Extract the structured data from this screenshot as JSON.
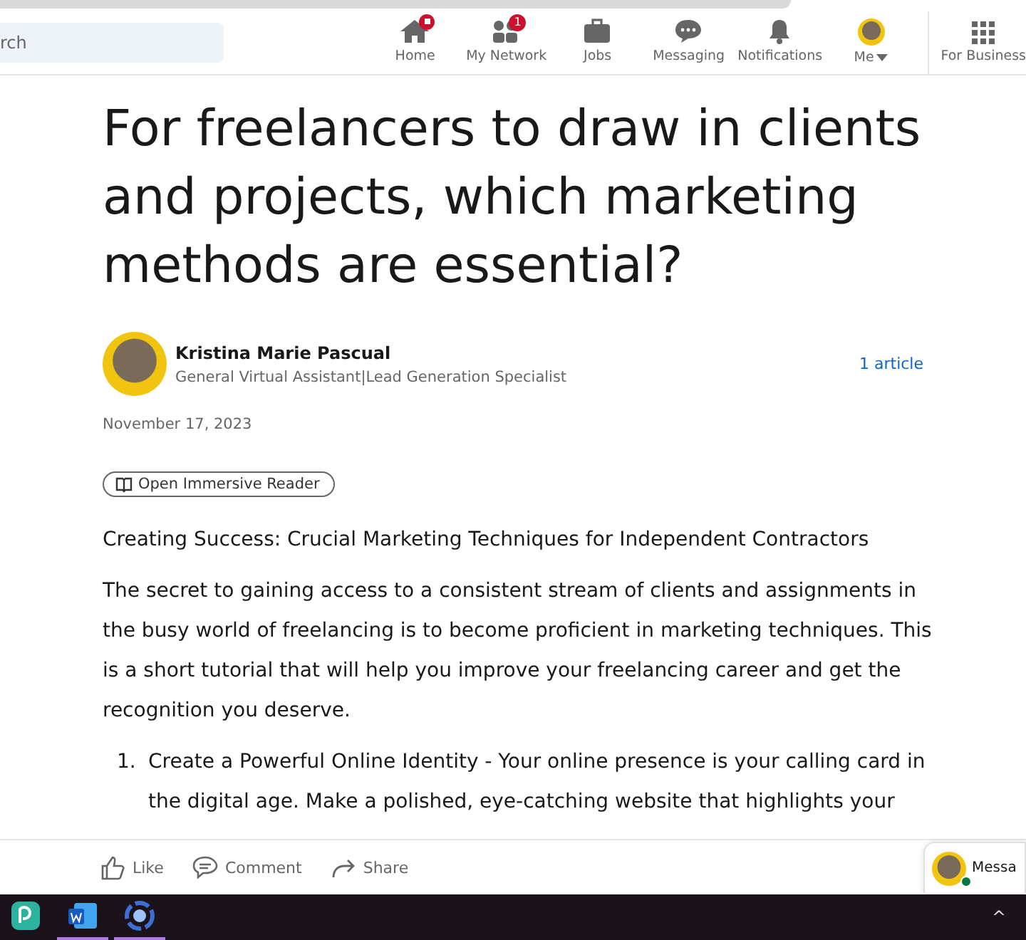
{
  "search": {
    "placeholder": "rch"
  },
  "nav": [
    {
      "label": "Home",
      "kind": "home",
      "dot": true,
      "selected": false
    },
    {
      "label": "My Network",
      "kind": "network",
      "badge": "1",
      "selected": false
    },
    {
      "label": "Jobs",
      "kind": "jobs",
      "selected": false
    },
    {
      "label": "Messaging",
      "kind": "messaging",
      "selected": false
    },
    {
      "label": "Notifications",
      "kind": "bell",
      "selected": false
    },
    {
      "label": "Me",
      "kind": "avatar",
      "caret": true,
      "selected": false
    }
  ],
  "business": {
    "label": "For Business"
  },
  "article": {
    "title": "For freelancers to draw in clients and projects, which marketing methods are essential?",
    "author": {
      "name": "Kristina Marie Pascual",
      "headline": "General Virtual Assistant|Lead Generation Specialist",
      "articles": "1 article"
    },
    "date": "November 17, 2023",
    "reader_button": "Open Immersive Reader",
    "subtitle": "Creating Success: Crucial Marketing Techniques for Independent Contractors",
    "paragraph": "The secret to gaining access to a consistent stream of clients and assignments in the busy world of freelancing is to become proficient in marketing techniques. This is a short tutorial that will help you improve your freelancing career and get the recognition you deserve.",
    "list": [
      {
        "number": "1.",
        "text": "Create a Powerful Online Identity - Your online presence is your calling card in the digital age. Make a polished, eye-catching website that highlights your"
      }
    ]
  },
  "actions": [
    {
      "label": "Like",
      "kind": "like"
    },
    {
      "label": "Comment",
      "kind": "comment"
    },
    {
      "label": "Share",
      "kind": "share"
    }
  ],
  "messaging": {
    "label": "Messa",
    "online": true
  },
  "taskbar": [
    {
      "kind": "app",
      "running": false
    },
    {
      "kind": "word",
      "running": true
    },
    {
      "kind": "ring",
      "running": true
    }
  ],
  "tray": [
    {
      "label": "^"
    }
  ]
}
